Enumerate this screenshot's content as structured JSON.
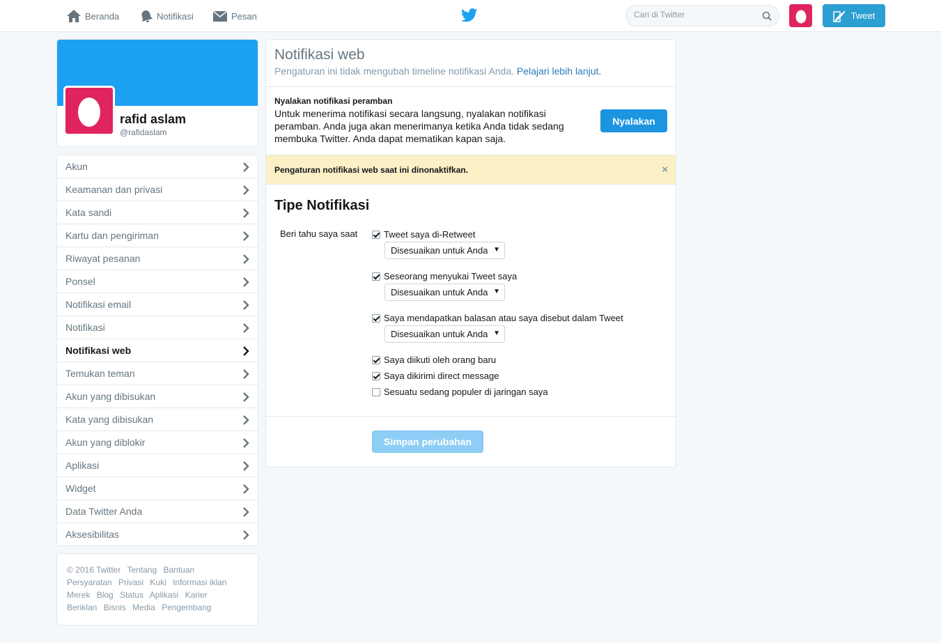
{
  "topnav": {
    "home": "Beranda",
    "notifications": "Notifikasi",
    "messages": "Pesan",
    "search_placeholder": "Cari di Twitter",
    "tweet_button": "Tweet"
  },
  "profile": {
    "name": "rafid aslam",
    "handle": "@rafidaslam"
  },
  "menu": {
    "items": [
      {
        "label": "Akun"
      },
      {
        "label": "Keamanan dan privasi"
      },
      {
        "label": "Kata sandi"
      },
      {
        "label": "Kartu dan pengiriman"
      },
      {
        "label": "Riwayat pesanan"
      },
      {
        "label": "Ponsel"
      },
      {
        "label": "Notifikasi email"
      },
      {
        "label": "Notifikasi"
      },
      {
        "label": "Notifikasi web"
      },
      {
        "label": "Temukan teman"
      },
      {
        "label": "Akun yang dibisukan"
      },
      {
        "label": "Kata yang dibisukan"
      },
      {
        "label": "Akun yang diblokir"
      },
      {
        "label": "Aplikasi"
      },
      {
        "label": "Widget"
      },
      {
        "label": "Data Twitter Anda"
      },
      {
        "label": "Aksesibilitas"
      }
    ],
    "active_index": 8
  },
  "footer": {
    "links": [
      "© 2016 Twitter",
      "Tentang",
      "Bantuan",
      "Persyaratan",
      "Privasi",
      "Kuki",
      "Informasi iklan",
      "Merek",
      "Blog",
      "Status",
      "Aplikasi",
      "Karier",
      "Beriklan",
      "Bisnis",
      "Media",
      "Pengembang"
    ]
  },
  "main": {
    "title": "Notifikasi web",
    "subtitle": "Pengaturan ini tidak mengubah timeline notifikasi Anda.",
    "learn_more": "Pelajari lebih lanjut.",
    "browser_title": "Nyalakan notifikasi peramban",
    "browser_text": "Untuk menerima notifikasi secara langsung, nyalakan notifikasi peramban. Anda juga akan menerimanya ketika Anda tidak sedang membuka Twitter. Anda dapat mematikan kapan saja.",
    "enable_button": "Nyalakan",
    "alert_text": "Pengaturan notifikasi web saat ini dinonaktifkan.",
    "alert_close": "×",
    "section_title": "Tipe Notifikasi",
    "notify_label": "Beri tahu saya saat",
    "options": [
      {
        "label": "Tweet saya di-Retweet",
        "checked": true,
        "select": "Disesuaikan untuk Anda"
      },
      {
        "label": "Seseorang menyukai Tweet saya",
        "checked": true,
        "select": "Disesuaikan untuk Anda"
      },
      {
        "label": "Saya mendapatkan balasan atau saya disebut dalam Tweet",
        "checked": true,
        "select": "Disesuaikan untuk Anda"
      },
      {
        "label": "Saya diikuti oleh orang baru",
        "checked": true
      },
      {
        "label": "Saya dikirimi direct message",
        "checked": true
      },
      {
        "label": "Sesuatu sedang populer di jaringan saya",
        "checked": false
      }
    ],
    "save_button": "Simpan perubahan"
  },
  "colors": {
    "brand": "#1da1f2",
    "avatar": "#e0245e",
    "alert_bg": "#fcf0c7"
  }
}
